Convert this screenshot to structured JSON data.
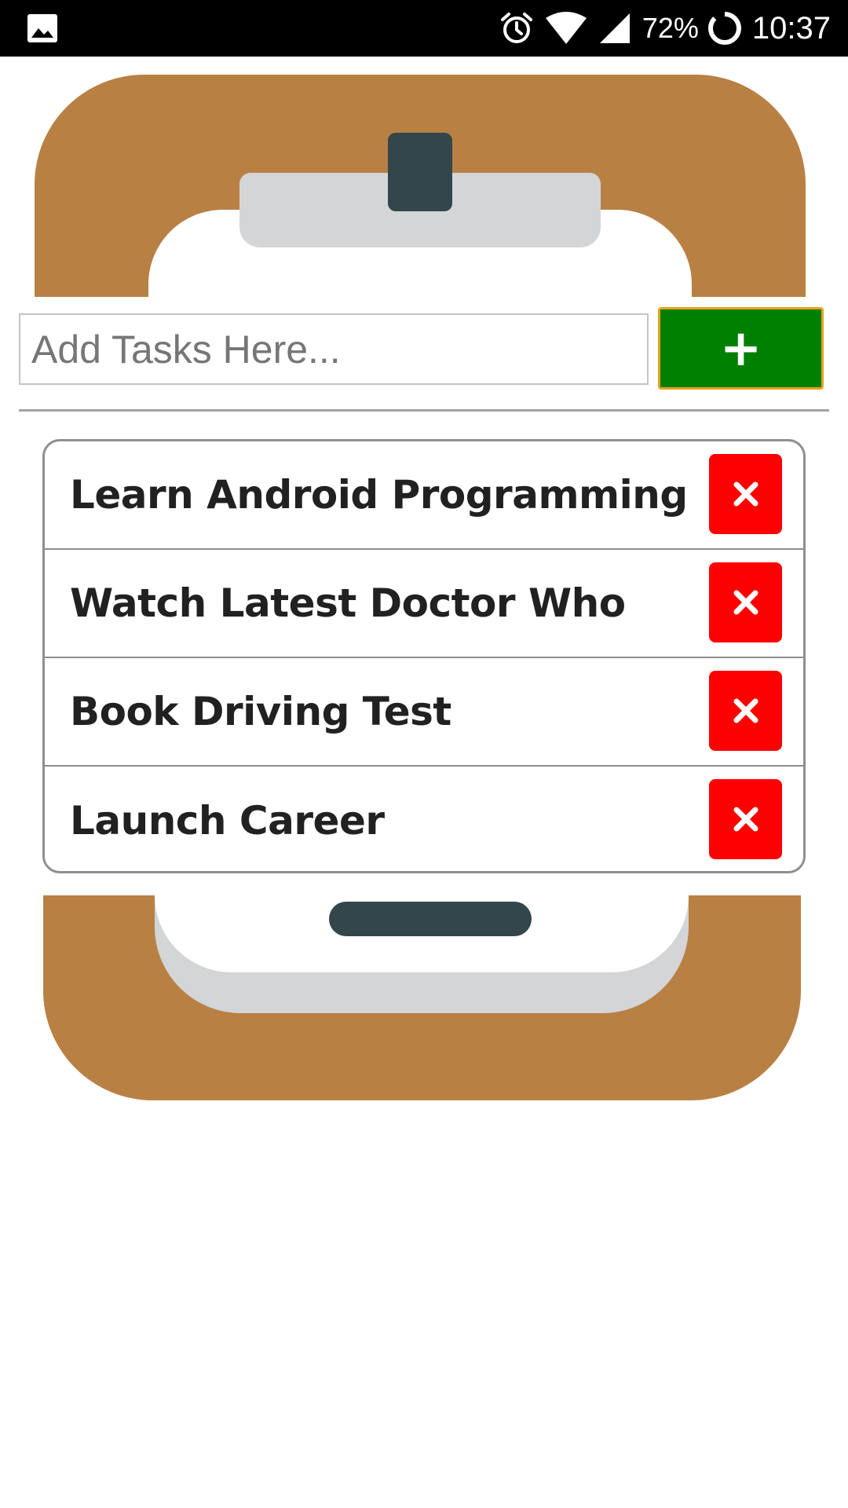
{
  "status_bar": {
    "icons": [
      "gallery-icon",
      "alarm-icon",
      "wifi-icon",
      "signal-icon",
      "battery-icon"
    ],
    "battery_percent": "72%",
    "time": "10:37"
  },
  "add_task": {
    "placeholder": "Add Tasks Here...",
    "button_label": "+"
  },
  "tasks": [
    {
      "label": "Learn Android Programming",
      "delete_icon": "close-icon"
    },
    {
      "label": "Watch Latest Doctor Who",
      "delete_icon": "close-icon"
    },
    {
      "label": "Book Driving Test",
      "delete_icon": "close-icon"
    },
    {
      "label": "Launch Career",
      "delete_icon": "close-icon"
    }
  ],
  "colors": {
    "clipboard_brown": "#b98044",
    "clamp_gray": "#d3d5d7",
    "clip_dark": "#32464b",
    "add_button_green": "#008000",
    "add_button_border": "#e8a21d",
    "delete_button_red": "#ff0000"
  }
}
